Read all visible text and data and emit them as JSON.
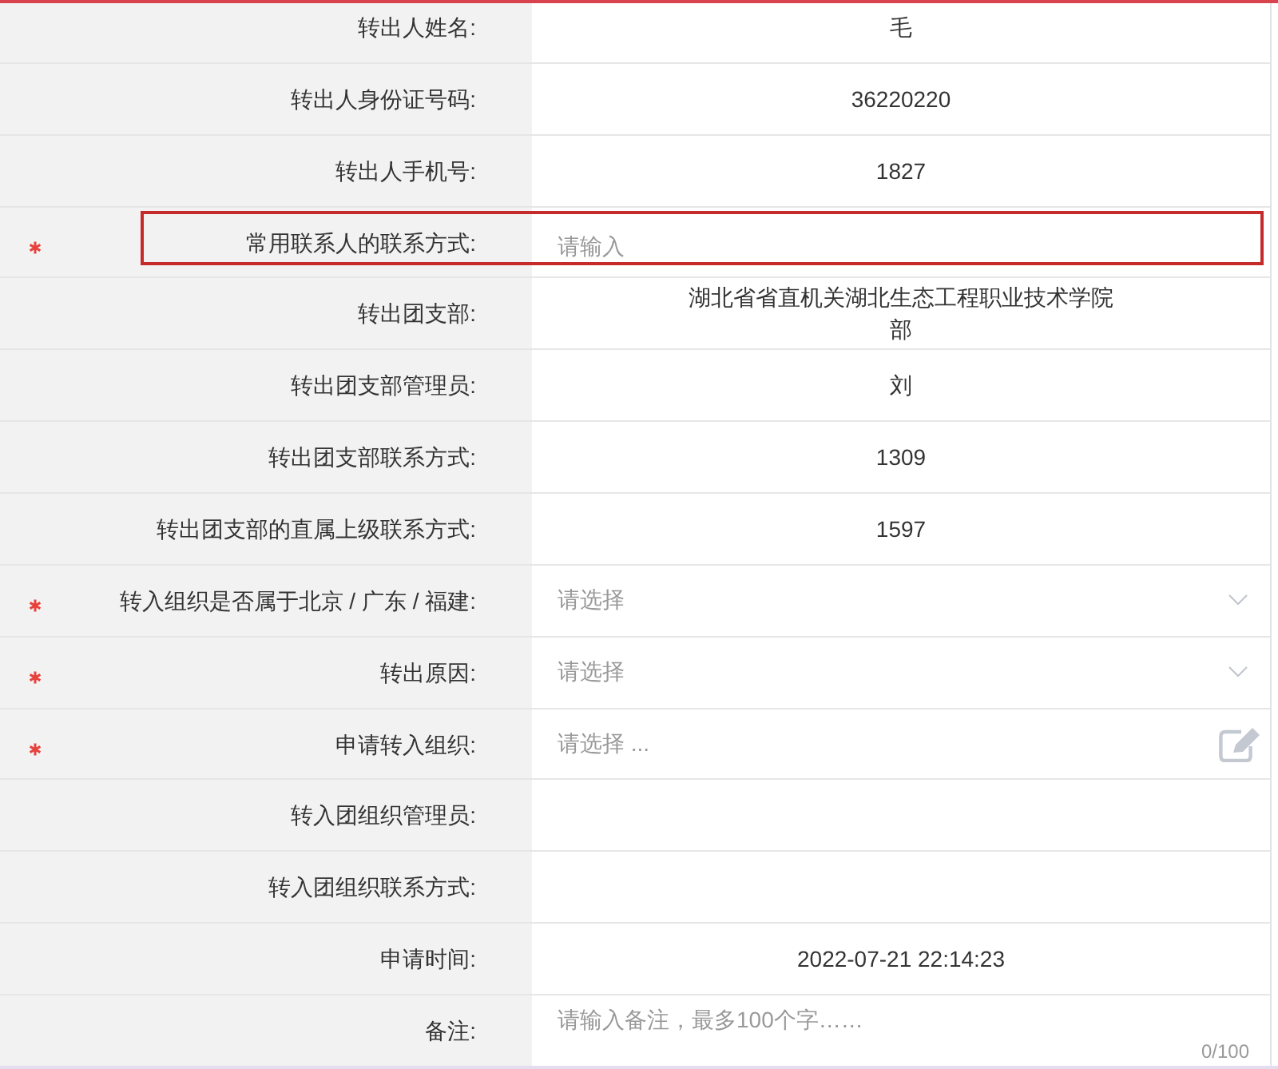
{
  "rows": [
    {
      "label": "转出人姓名:",
      "required": false,
      "highlighted": false,
      "kind": "text",
      "value": "毛"
    },
    {
      "label": "转出人身份证号码:",
      "required": false,
      "highlighted": false,
      "kind": "text",
      "value": "36220220"
    },
    {
      "label": "转出人手机号:",
      "required": false,
      "highlighted": false,
      "kind": "text",
      "value": "1827"
    },
    {
      "label": "常用联系人的联系方式:",
      "required": true,
      "highlighted": true,
      "kind": "input",
      "placeholder": "请输入"
    },
    {
      "label": "转出团支部:",
      "required": false,
      "highlighted": false,
      "kind": "text",
      "lines": [
        "湖北省省直机关湖北生态工程职业技术学院",
        "部"
      ]
    },
    {
      "label": "转出团支部管理员:",
      "required": false,
      "highlighted": false,
      "kind": "text",
      "value": "刘"
    },
    {
      "label": "转出团支部联系方式:",
      "required": false,
      "highlighted": false,
      "kind": "text",
      "value": "1309"
    },
    {
      "label": "转出团支部的直属上级联系方式:",
      "required": false,
      "highlighted": false,
      "kind": "text",
      "value": "1597"
    },
    {
      "label": "转入组织是否属于北京 / 广东 / 福建:",
      "required": true,
      "highlighted": false,
      "kind": "select",
      "placeholder": "请选择"
    },
    {
      "label": "转出原因:",
      "required": true,
      "highlighted": false,
      "kind": "select",
      "placeholder": "请选择"
    },
    {
      "label": "申请转入组织:",
      "required": true,
      "highlighted": false,
      "kind": "picker",
      "placeholder": "请选择 ..."
    },
    {
      "label": "转入团组织管理员:",
      "required": false,
      "highlighted": false,
      "kind": "text"
    },
    {
      "label": "转入团组织联系方式:",
      "required": false,
      "highlighted": false,
      "kind": "text"
    },
    {
      "label": "申请时间:",
      "required": false,
      "highlighted": false,
      "kind": "text",
      "value": "2022-07-21 22:14:23"
    },
    {
      "label": "备注:",
      "required": false,
      "highlighted": false,
      "kind": "textarea",
      "placeholder": "请输入备注，最多100个字……",
      "counter": "0/100"
    }
  ]
}
